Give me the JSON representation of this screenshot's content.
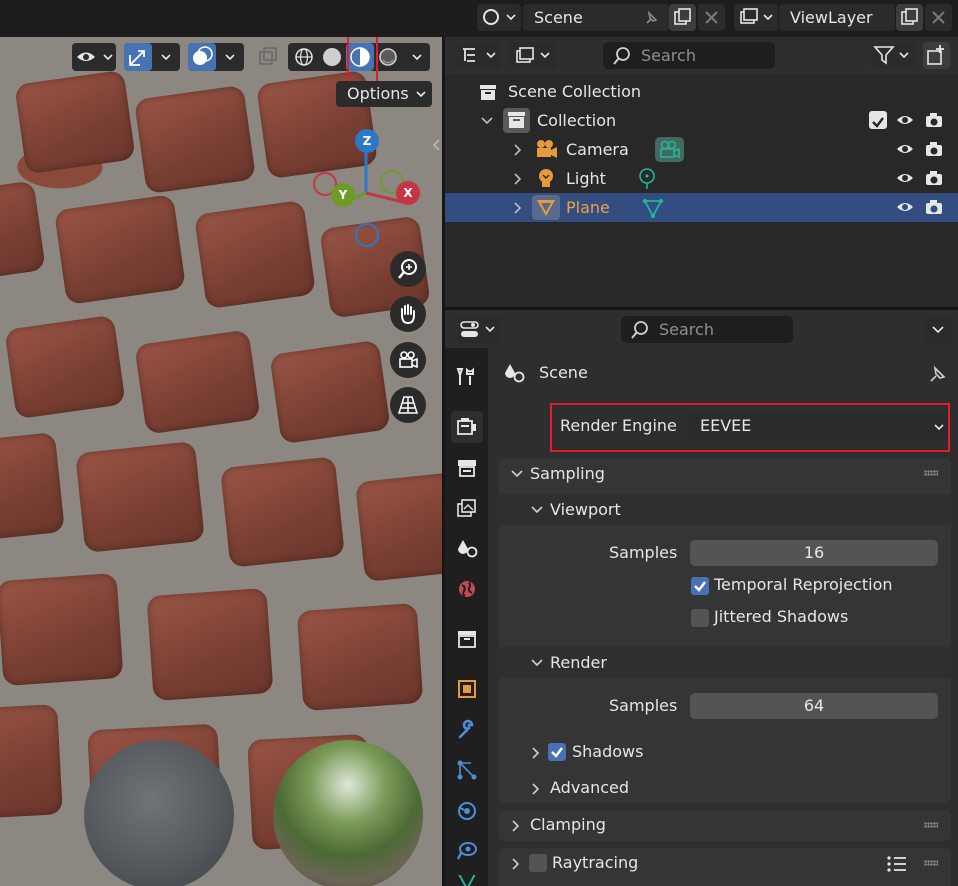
{
  "topbar": {
    "scene_name": "Scene",
    "viewlayer_name": "ViewLayer"
  },
  "viewport": {
    "options_label": "Options",
    "gizmo": {
      "z": "Z",
      "y": "Y",
      "x": "X"
    }
  },
  "outliner": {
    "search_placeholder": "Search",
    "rows": [
      {
        "label": "Scene Collection"
      },
      {
        "label": "Collection"
      },
      {
        "label": "Camera"
      },
      {
        "label": "Light"
      },
      {
        "label": "Plane"
      }
    ]
  },
  "properties": {
    "search_placeholder": "Search",
    "context_title": "Scene",
    "render_engine_label": "Render Engine",
    "render_engine_value": "EEVEE",
    "sampling_label": "Sampling",
    "viewport_label": "Viewport",
    "viewport_samples_label": "Samples",
    "viewport_samples_value": "16",
    "temporal_reprojection_label": "Temporal Reprojection",
    "jittered_shadows_label": "Jittered Shadows",
    "render_label": "Render",
    "render_samples_label": "Samples",
    "render_samples_value": "64",
    "shadows_label": "Shadows",
    "advanced_label": "Advanced",
    "clamping_label": "Clamping",
    "raytracing_label": "Raytracing"
  },
  "colors": {
    "selection": "#334d80",
    "highlight_box": "#e01e2b",
    "checkbox_on": "#4772b3",
    "camera_accent": "#e69a3b",
    "data_accent": "#21b59c"
  }
}
